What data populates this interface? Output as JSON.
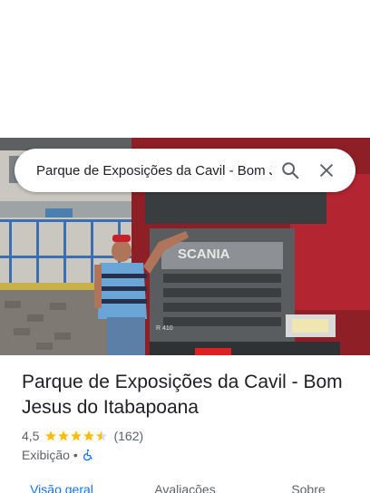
{
  "search": {
    "query": "Parque de Exposições da Cavil - Bom Jesus do Itabapoana"
  },
  "place": {
    "title": "Parque de Exposições da Cavil - Bom Jesus do Itabapoana",
    "rating": "4,5",
    "rating_stars": 4.5,
    "review_count": "(162)",
    "category": "Exibição",
    "separator": "•",
    "accessibility_icon": "wheelchair-icon"
  },
  "photo": {
    "truck_brand": "SCANIA",
    "truck_model": "R 410"
  },
  "tabs": [
    {
      "label": "Visão geral",
      "active": true
    },
    {
      "label": "Avaliações",
      "active": false
    },
    {
      "label": "Sobre",
      "active": false
    }
  ],
  "colors": {
    "accent": "#1a73e8",
    "star": "#fbbc04",
    "accessibility": "#1a73e8",
    "text_primary": "#202124",
    "text_secondary": "#5f6368"
  }
}
